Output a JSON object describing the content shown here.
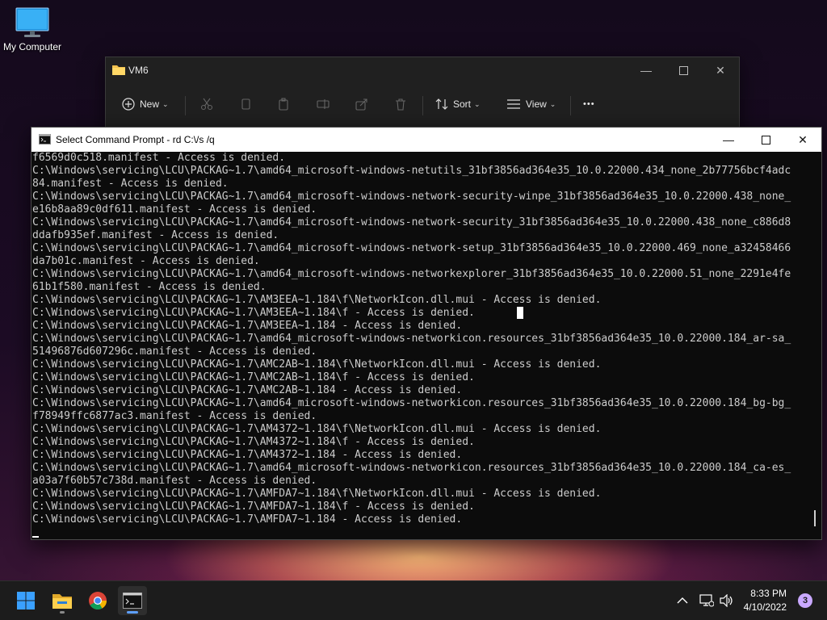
{
  "desktop": {
    "icon_label": "My Computer"
  },
  "explorer": {
    "title": "VM6",
    "toolbar": {
      "new_label": "New",
      "sort_label": "Sort",
      "view_label": "View",
      "more_label": "•••"
    }
  },
  "cmd": {
    "title": "Select Command Prompt - rd  C:\\/s /q",
    "lines": [
      "f6569d0c518.manifest - Access is denied.",
      "C:\\Windows\\servicing\\LCU\\PACKAG~1.7\\amd64_microsoft-windows-netutils_31bf3856ad364e35_10.0.22000.434_none_2b77756bcf4adc",
      "84.manifest - Access is denied.",
      "C:\\Windows\\servicing\\LCU\\PACKAG~1.7\\amd64_microsoft-windows-network-security-winpe_31bf3856ad364e35_10.0.22000.438_none_",
      "e16b8aa89c0df611.manifest - Access is denied.",
      "C:\\Windows\\servicing\\LCU\\PACKAG~1.7\\amd64_microsoft-windows-network-security_31bf3856ad364e35_10.0.22000.438_none_c886d8",
      "ddafb935ef.manifest - Access is denied.",
      "C:\\Windows\\servicing\\LCU\\PACKAG~1.7\\amd64_microsoft-windows-network-setup_31bf3856ad364e35_10.0.22000.469_none_a32458466",
      "da7b01c.manifest - Access is denied.",
      "C:\\Windows\\servicing\\LCU\\PACKAG~1.7\\amd64_microsoft-windows-networkexplorer_31bf3856ad364e35_10.0.22000.51_none_2291e4fe",
      "61b1f580.manifest - Access is denied.",
      "C:\\Windows\\servicing\\LCU\\PACKAG~1.7\\AM3EEA~1.184\\f\\NetworkIcon.dll.mui - Access is denied.",
      "C:\\Windows\\servicing\\LCU\\PACKAG~1.7\\AM3EEA~1.184\\f - Access is denied.",
      "C:\\Windows\\servicing\\LCU\\PACKAG~1.7\\AM3EEA~1.184 - Access is denied.",
      "C:\\Windows\\servicing\\LCU\\PACKAG~1.7\\amd64_microsoft-windows-networkicon.resources_31bf3856ad364e35_10.0.22000.184_ar-sa_",
      "51496876d607296c.manifest - Access is denied.",
      "C:\\Windows\\servicing\\LCU\\PACKAG~1.7\\AMC2AB~1.184\\f\\NetworkIcon.dll.mui - Access is denied.",
      "C:\\Windows\\servicing\\LCU\\PACKAG~1.7\\AMC2AB~1.184\\f - Access is denied.",
      "C:\\Windows\\servicing\\LCU\\PACKAG~1.7\\AMC2AB~1.184 - Access is denied.",
      "C:\\Windows\\servicing\\LCU\\PACKAG~1.7\\amd64_microsoft-windows-networkicon.resources_31bf3856ad364e35_10.0.22000.184_bg-bg_",
      "f78949ffc6877ac3.manifest - Access is denied.",
      "C:\\Windows\\servicing\\LCU\\PACKAG~1.7\\AM4372~1.184\\f\\NetworkIcon.dll.mui - Access is denied.",
      "C:\\Windows\\servicing\\LCU\\PACKAG~1.7\\AM4372~1.184\\f - Access is denied.",
      "C:\\Windows\\servicing\\LCU\\PACKAG~1.7\\AM4372~1.184 - Access is denied.",
      "C:\\Windows\\servicing\\LCU\\PACKAG~1.7\\amd64_microsoft-windows-networkicon.resources_31bf3856ad364e35_10.0.22000.184_ca-es_",
      "a03a7f60b57c738d.manifest - Access is denied.",
      "C:\\Windows\\servicing\\LCU\\PACKAG~1.7\\AMFDA7~1.184\\f\\NetworkIcon.dll.mui - Access is denied.",
      "C:\\Windows\\servicing\\LCU\\PACKAG~1.7\\AMFDA7~1.184\\f - Access is denied.",
      "C:\\Windows\\servicing\\LCU\\PACKAG~1.7\\AMFDA7~1.184 - Access is denied."
    ]
  },
  "taskbar": {
    "time": "8:33 PM",
    "date": "4/10/2022",
    "notification_count": "3"
  }
}
